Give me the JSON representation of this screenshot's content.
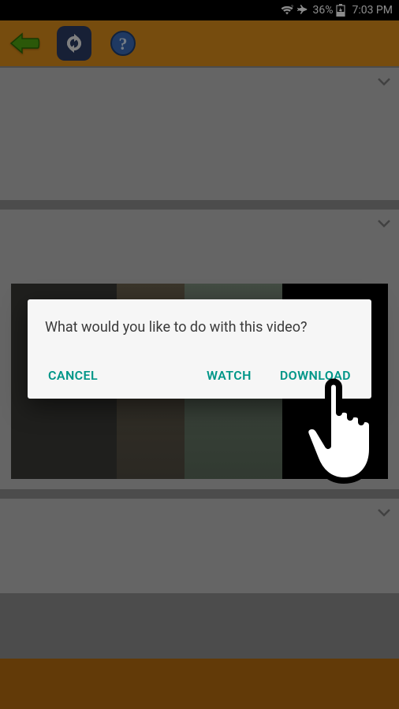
{
  "status": {
    "battery": "36%",
    "time": "7:03 PM"
  },
  "dialog": {
    "message": "What would you like to do with this video?",
    "cancel": "CANCEL",
    "watch": "WATCH",
    "download": "DOWNLOAD"
  }
}
